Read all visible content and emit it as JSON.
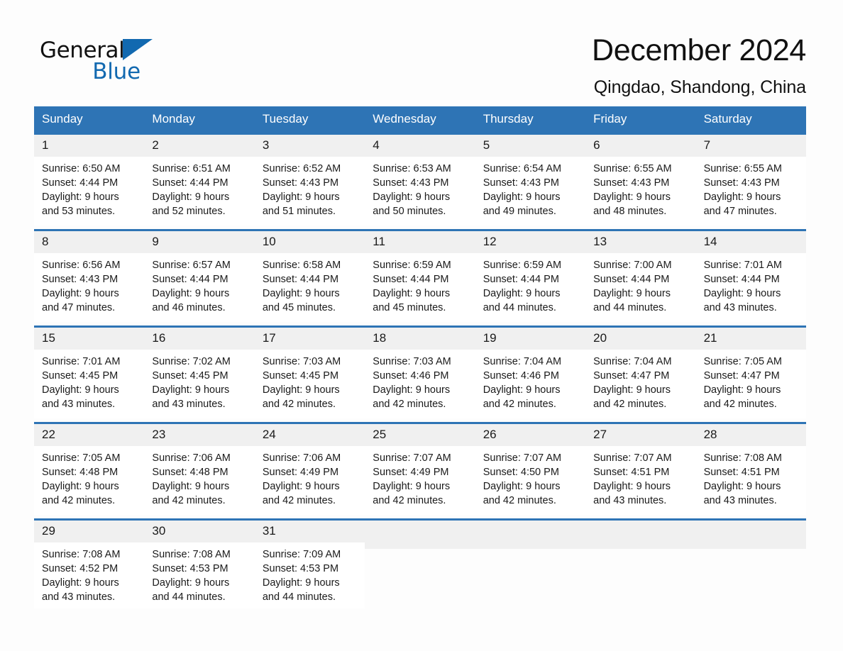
{
  "logo": {
    "word_top": "General",
    "word_bottom": "Blue",
    "triangle_color": "#1269b0"
  },
  "header": {
    "title": "December 2024",
    "subtitle": "Qingdao, Shandong, China",
    "accent_color": "#2e74b5"
  },
  "calendar": {
    "weekdays": [
      "Sunday",
      "Monday",
      "Tuesday",
      "Wednesday",
      "Thursday",
      "Friday",
      "Saturday"
    ],
    "weeks": [
      [
        {
          "day": "1",
          "sunrise": "Sunrise: 6:50 AM",
          "sunset": "Sunset: 4:44 PM",
          "daylight_line1": "Daylight: 9 hours",
          "daylight_line2": "and 53 minutes."
        },
        {
          "day": "2",
          "sunrise": "Sunrise: 6:51 AM",
          "sunset": "Sunset: 4:44 PM",
          "daylight_line1": "Daylight: 9 hours",
          "daylight_line2": "and 52 minutes."
        },
        {
          "day": "3",
          "sunrise": "Sunrise: 6:52 AM",
          "sunset": "Sunset: 4:43 PM",
          "daylight_line1": "Daylight: 9 hours",
          "daylight_line2": "and 51 minutes."
        },
        {
          "day": "4",
          "sunrise": "Sunrise: 6:53 AM",
          "sunset": "Sunset: 4:43 PM",
          "daylight_line1": "Daylight: 9 hours",
          "daylight_line2": "and 50 minutes."
        },
        {
          "day": "5",
          "sunrise": "Sunrise: 6:54 AM",
          "sunset": "Sunset: 4:43 PM",
          "daylight_line1": "Daylight: 9 hours",
          "daylight_line2": "and 49 minutes."
        },
        {
          "day": "6",
          "sunrise": "Sunrise: 6:55 AM",
          "sunset": "Sunset: 4:43 PM",
          "daylight_line1": "Daylight: 9 hours",
          "daylight_line2": "and 48 minutes."
        },
        {
          "day": "7",
          "sunrise": "Sunrise: 6:55 AM",
          "sunset": "Sunset: 4:43 PM",
          "daylight_line1": "Daylight: 9 hours",
          "daylight_line2": "and 47 minutes."
        }
      ],
      [
        {
          "day": "8",
          "sunrise": "Sunrise: 6:56 AM",
          "sunset": "Sunset: 4:43 PM",
          "daylight_line1": "Daylight: 9 hours",
          "daylight_line2": "and 47 minutes."
        },
        {
          "day": "9",
          "sunrise": "Sunrise: 6:57 AM",
          "sunset": "Sunset: 4:44 PM",
          "daylight_line1": "Daylight: 9 hours",
          "daylight_line2": "and 46 minutes."
        },
        {
          "day": "10",
          "sunrise": "Sunrise: 6:58 AM",
          "sunset": "Sunset: 4:44 PM",
          "daylight_line1": "Daylight: 9 hours",
          "daylight_line2": "and 45 minutes."
        },
        {
          "day": "11",
          "sunrise": "Sunrise: 6:59 AM",
          "sunset": "Sunset: 4:44 PM",
          "daylight_line1": "Daylight: 9 hours",
          "daylight_line2": "and 45 minutes."
        },
        {
          "day": "12",
          "sunrise": "Sunrise: 6:59 AM",
          "sunset": "Sunset: 4:44 PM",
          "daylight_line1": "Daylight: 9 hours",
          "daylight_line2": "and 44 minutes."
        },
        {
          "day": "13",
          "sunrise": "Sunrise: 7:00 AM",
          "sunset": "Sunset: 4:44 PM",
          "daylight_line1": "Daylight: 9 hours",
          "daylight_line2": "and 44 minutes."
        },
        {
          "day": "14",
          "sunrise": "Sunrise: 7:01 AM",
          "sunset": "Sunset: 4:44 PM",
          "daylight_line1": "Daylight: 9 hours",
          "daylight_line2": "and 43 minutes."
        }
      ],
      [
        {
          "day": "15",
          "sunrise": "Sunrise: 7:01 AM",
          "sunset": "Sunset: 4:45 PM",
          "daylight_line1": "Daylight: 9 hours",
          "daylight_line2": "and 43 minutes."
        },
        {
          "day": "16",
          "sunrise": "Sunrise: 7:02 AM",
          "sunset": "Sunset: 4:45 PM",
          "daylight_line1": "Daylight: 9 hours",
          "daylight_line2": "and 43 minutes."
        },
        {
          "day": "17",
          "sunrise": "Sunrise: 7:03 AM",
          "sunset": "Sunset: 4:45 PM",
          "daylight_line1": "Daylight: 9 hours",
          "daylight_line2": "and 42 minutes."
        },
        {
          "day": "18",
          "sunrise": "Sunrise: 7:03 AM",
          "sunset": "Sunset: 4:46 PM",
          "daylight_line1": "Daylight: 9 hours",
          "daylight_line2": "and 42 minutes."
        },
        {
          "day": "19",
          "sunrise": "Sunrise: 7:04 AM",
          "sunset": "Sunset: 4:46 PM",
          "daylight_line1": "Daylight: 9 hours",
          "daylight_line2": "and 42 minutes."
        },
        {
          "day": "20",
          "sunrise": "Sunrise: 7:04 AM",
          "sunset": "Sunset: 4:47 PM",
          "daylight_line1": "Daylight: 9 hours",
          "daylight_line2": "and 42 minutes."
        },
        {
          "day": "21",
          "sunrise": "Sunrise: 7:05 AM",
          "sunset": "Sunset: 4:47 PM",
          "daylight_line1": "Daylight: 9 hours",
          "daylight_line2": "and 42 minutes."
        }
      ],
      [
        {
          "day": "22",
          "sunrise": "Sunrise: 7:05 AM",
          "sunset": "Sunset: 4:48 PM",
          "daylight_line1": "Daylight: 9 hours",
          "daylight_line2": "and 42 minutes."
        },
        {
          "day": "23",
          "sunrise": "Sunrise: 7:06 AM",
          "sunset": "Sunset: 4:48 PM",
          "daylight_line1": "Daylight: 9 hours",
          "daylight_line2": "and 42 minutes."
        },
        {
          "day": "24",
          "sunrise": "Sunrise: 7:06 AM",
          "sunset": "Sunset: 4:49 PM",
          "daylight_line1": "Daylight: 9 hours",
          "daylight_line2": "and 42 minutes."
        },
        {
          "day": "25",
          "sunrise": "Sunrise: 7:07 AM",
          "sunset": "Sunset: 4:49 PM",
          "daylight_line1": "Daylight: 9 hours",
          "daylight_line2": "and 42 minutes."
        },
        {
          "day": "26",
          "sunrise": "Sunrise: 7:07 AM",
          "sunset": "Sunset: 4:50 PM",
          "daylight_line1": "Daylight: 9 hours",
          "daylight_line2": "and 42 minutes."
        },
        {
          "day": "27",
          "sunrise": "Sunrise: 7:07 AM",
          "sunset": "Sunset: 4:51 PM",
          "daylight_line1": "Daylight: 9 hours",
          "daylight_line2": "and 43 minutes."
        },
        {
          "day": "28",
          "sunrise": "Sunrise: 7:08 AM",
          "sunset": "Sunset: 4:51 PM",
          "daylight_line1": "Daylight: 9 hours",
          "daylight_line2": "and 43 minutes."
        }
      ],
      [
        {
          "day": "29",
          "sunrise": "Sunrise: 7:08 AM",
          "sunset": "Sunset: 4:52 PM",
          "daylight_line1": "Daylight: 9 hours",
          "daylight_line2": "and 43 minutes."
        },
        {
          "day": "30",
          "sunrise": "Sunrise: 7:08 AM",
          "sunset": "Sunset: 4:53 PM",
          "daylight_line1": "Daylight: 9 hours",
          "daylight_line2": "and 44 minutes."
        },
        {
          "day": "31",
          "sunrise": "Sunrise: 7:09 AM",
          "sunset": "Sunset: 4:53 PM",
          "daylight_line1": "Daylight: 9 hours",
          "daylight_line2": "and 44 minutes."
        },
        {
          "day": "",
          "sunrise": "",
          "sunset": "",
          "daylight_line1": "",
          "daylight_line2": ""
        },
        {
          "day": "",
          "sunrise": "",
          "sunset": "",
          "daylight_line1": "",
          "daylight_line2": ""
        },
        {
          "day": "",
          "sunrise": "",
          "sunset": "",
          "daylight_line1": "",
          "daylight_line2": ""
        },
        {
          "day": "",
          "sunrise": "",
          "sunset": "",
          "daylight_line1": "",
          "daylight_line2": ""
        }
      ]
    ]
  }
}
